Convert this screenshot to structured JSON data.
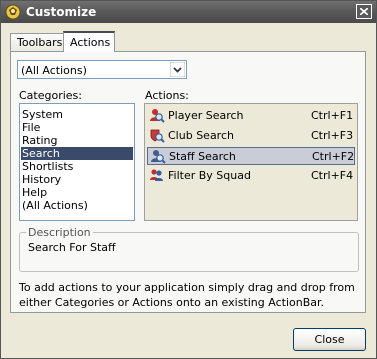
{
  "window": {
    "title": "Customize",
    "icon": "app-ball-icon"
  },
  "tabs": [
    {
      "label": "Toolbars",
      "selected": false
    },
    {
      "label": "Actions",
      "selected": true
    }
  ],
  "filter": {
    "selected": "(All Actions)"
  },
  "categories": {
    "label": "Categories:",
    "items": [
      "System",
      "File",
      "Rating",
      "Search",
      "Shortlists",
      "History",
      "Help",
      "(All Actions)"
    ],
    "selected": "Search"
  },
  "actions": {
    "label": "Actions:",
    "items": [
      {
        "name": "Player Search",
        "shortcut": "Ctrl+F1",
        "icon": "player-search-icon"
      },
      {
        "name": "Club Search",
        "shortcut": "Ctrl+F3",
        "icon": "club-search-icon"
      },
      {
        "name": "Staff Search",
        "shortcut": "Ctrl+F2",
        "icon": "staff-search-icon"
      },
      {
        "name": "Filter By Squad",
        "shortcut": "Ctrl+F4",
        "icon": "filter-squad-icon"
      }
    ],
    "selected": "Staff Search"
  },
  "description": {
    "legend": "Description",
    "text": "Search For Staff"
  },
  "help_text": "To add actions to your application simply drag and drop from either Categories or Actions onto an existing ActionBar.",
  "buttons": {
    "close": "Close"
  },
  "colors": {
    "titlebar": "#5a5a5a",
    "selection": "#3a4a6a",
    "panel": "#ece9d8"
  }
}
